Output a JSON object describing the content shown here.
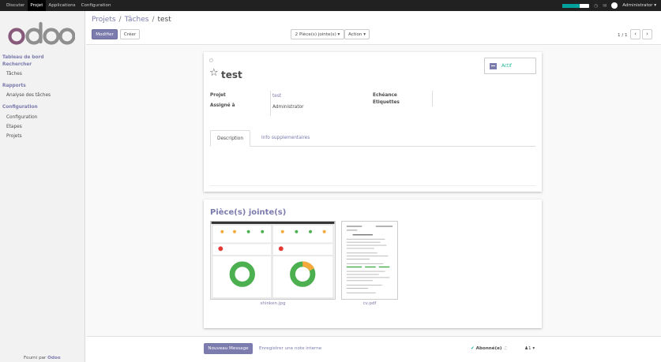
{
  "topbar": {
    "menus": [
      {
        "label": "Discuter",
        "active": false
      },
      {
        "label": "Projet",
        "active": true
      },
      {
        "label": "Applications",
        "active": false
      },
      {
        "label": "Configuration",
        "active": false
      }
    ],
    "progress_fraction": 0.65,
    "username": "Administrator",
    "user_caret": "▾"
  },
  "sidebar": {
    "logo_text": "odoo",
    "groups": [
      {
        "label": "Tableau de bord"
      },
      {
        "label": "Rechercher"
      },
      {
        "label": "Rapports"
      },
      {
        "label": "Configuration"
      }
    ],
    "items": [
      {
        "label": "Tâches"
      },
      {
        "label": "Analyse des tâches"
      },
      {
        "label": "Configuration"
      },
      {
        "label": "Etapes"
      },
      {
        "label": "Projets"
      }
    ],
    "powered_prefix": "Fourni par",
    "powered_brand": "Odoo"
  },
  "control": {
    "breadcrumb": [
      "Projets",
      "Tâches",
      "test"
    ],
    "sep": "/",
    "edit_label": "Modifier",
    "create_label": "Créer",
    "attachments_label": "2 Pièce(s) jointe(s) ▾",
    "action_label": "Action ▾",
    "pager_value": "1 / 1",
    "prev": "‹",
    "next": "›"
  },
  "form": {
    "title": "test",
    "star": "☆",
    "status_label": "Actif",
    "fields": {
      "project_label": "Projet",
      "project_value": "test",
      "assigned_label": "Assigné à",
      "assigned_value": "Administrator",
      "deadline_label": "Echéance",
      "tags_label": "Etiquettes"
    },
    "tabs": [
      {
        "label": "Description",
        "active": true
      },
      {
        "label": "Info supplementaires",
        "active": false
      }
    ]
  },
  "attachments": {
    "title": "Pièce(s) jointe(s)",
    "files": [
      {
        "name": "shinken.jpg"
      },
      {
        "name": "cv.pdf"
      }
    ]
  },
  "chatter": {
    "new_message": "Nouveau Message",
    "log_note": "Enregistrer une note interne",
    "followed_label": "Abonné(e)",
    "followers_count": "1",
    "caret": "▾"
  },
  "colors": {
    "brand": "#7c7bad",
    "active_status": "#21b799",
    "topbar": "#212121",
    "donut_green": "#4caf50",
    "donut_orange": "#f4a93a"
  }
}
